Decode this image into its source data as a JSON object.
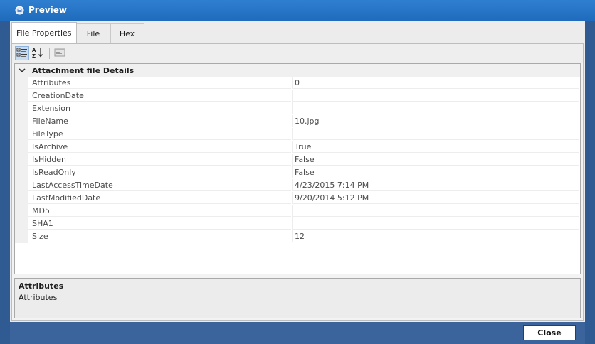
{
  "window": {
    "title": "Preview"
  },
  "tabs": [
    {
      "label": "File Properties",
      "active": true
    },
    {
      "label": "File",
      "active": false
    },
    {
      "label": "Hex",
      "active": false
    }
  ],
  "toolbar": {
    "categorized_icon": "categorized-icon",
    "alphabetical_icon": "sort-alphabetical-icon",
    "property_pages_icon": "property-pages-icon"
  },
  "grid": {
    "category": "Attachment file Details",
    "rows": [
      {
        "name": "Attributes",
        "value": "0"
      },
      {
        "name": "CreationDate",
        "value": ""
      },
      {
        "name": "Extension",
        "value": ""
      },
      {
        "name": "FileName",
        "value": "10.jpg"
      },
      {
        "name": "FileType",
        "value": ""
      },
      {
        "name": "IsArchive",
        "value": "True"
      },
      {
        "name": "IsHidden",
        "value": "False"
      },
      {
        "name": "IsReadOnly",
        "value": "False"
      },
      {
        "name": "LastAccessTimeDate",
        "value": "4/23/2015 7:14 PM"
      },
      {
        "name": "LastModifiedDate",
        "value": "9/20/2014 5:12 PM"
      },
      {
        "name": "MD5",
        "value": ""
      },
      {
        "name": "SHA1",
        "value": ""
      },
      {
        "name": "Size",
        "value": "12"
      }
    ]
  },
  "help": {
    "title": "Attributes",
    "description": "Attributes"
  },
  "footer": {
    "close_label": "Close"
  },
  "colors": {
    "titlebar": "#1f6bbd",
    "footer": "#3a649b"
  }
}
